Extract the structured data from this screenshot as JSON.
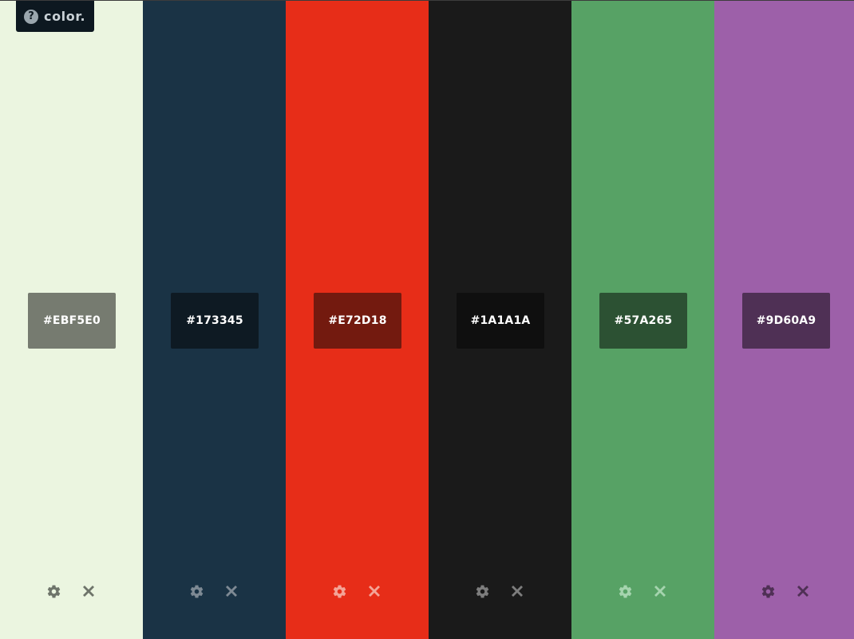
{
  "app": {
    "logo_icon": "?",
    "logo_text": "color."
  },
  "swatches": [
    {
      "hex": "#EBF5E0",
      "bg": "#EBF5E0",
      "box": "#767B70",
      "icon": "#6E746A"
    },
    {
      "hex": "#173345",
      "bg": "#1A3345",
      "box": "#0E1A23",
      "icon": "#7E8A94"
    },
    {
      "hex": "#E72D18",
      "bg": "#E72D18",
      "box": "#731A0F",
      "icon": "#F4A497"
    },
    {
      "hex": "#1A1A1A",
      "bg": "#1A1A1A",
      "box": "#0F0F0F",
      "icon": "#7D7D7D"
    },
    {
      "hex": "#57A265",
      "bg": "#57A265",
      "box": "#2C5133",
      "icon": "#A5D4AE"
    },
    {
      "hex": "#9D60A9",
      "bg": "#9D60A9",
      "box": "#4F3055",
      "icon": "#4F3055"
    }
  ],
  "icons": {
    "settings": "gear-icon",
    "remove": "close-icon",
    "help": "question-icon"
  }
}
